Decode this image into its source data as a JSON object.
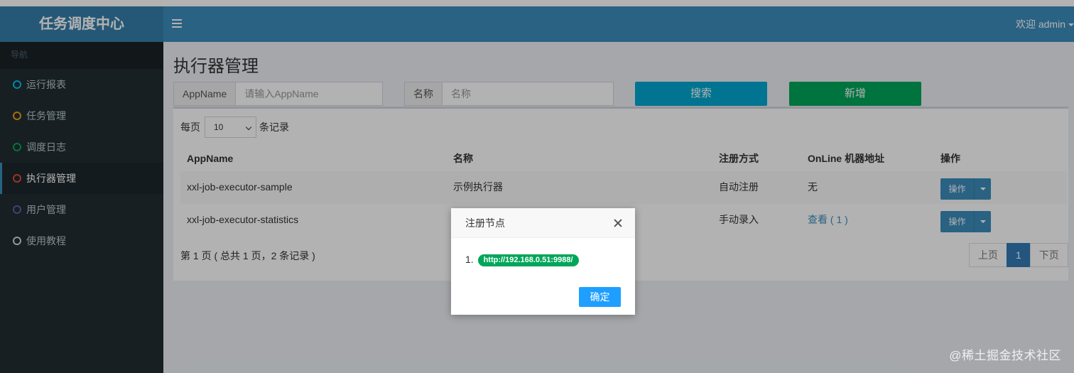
{
  "header": {
    "logo": "任务调度中心",
    "user": "欢迎 admin"
  },
  "sidebar": {
    "header": "导航",
    "items": [
      {
        "label": "运行报表",
        "color": "#00c0ef"
      },
      {
        "label": "任务管理",
        "color": "#f39c12"
      },
      {
        "label": "调度日志",
        "color": "#00a65a"
      },
      {
        "label": "执行器管理",
        "color": "#dd4b39"
      },
      {
        "label": "用户管理",
        "color": "#605ca8"
      },
      {
        "label": "使用教程",
        "color": "#d2d6de"
      }
    ]
  },
  "main": {
    "title": "执行器管理",
    "search": {
      "appname_label": "AppName",
      "appname_placeholder": "请输入AppName",
      "name_label": "名称",
      "name_placeholder": "名称",
      "search_button": "搜索",
      "add_button": "新增"
    },
    "length": {
      "prefix": "每页",
      "value": "10",
      "suffix": "条记录"
    },
    "table": {
      "headers": [
        "AppName",
        "名称",
        "注册方式",
        "OnLine 机器地址",
        "操作"
      ],
      "rows": [
        {
          "appname": "xxl-job-executor-sample",
          "name": "示例执行器",
          "type": "自动注册",
          "online": "无",
          "action": "操作"
        },
        {
          "appname": "xxl-job-executor-statistics",
          "name": "",
          "type": "手动录入",
          "online": "查看 ( 1 )",
          "action": "操作"
        }
      ]
    },
    "info": "第 1 页 ( 总共 1 页，2 条记录 )",
    "pagination": {
      "prev": "上页",
      "current": "1",
      "next": "下页"
    }
  },
  "modal": {
    "title": "注册节点",
    "item_index": "1.",
    "address": "http://192.168.0.51:9988/",
    "ok_button": "确定"
  },
  "watermark": "@稀土掘金技术社区"
}
